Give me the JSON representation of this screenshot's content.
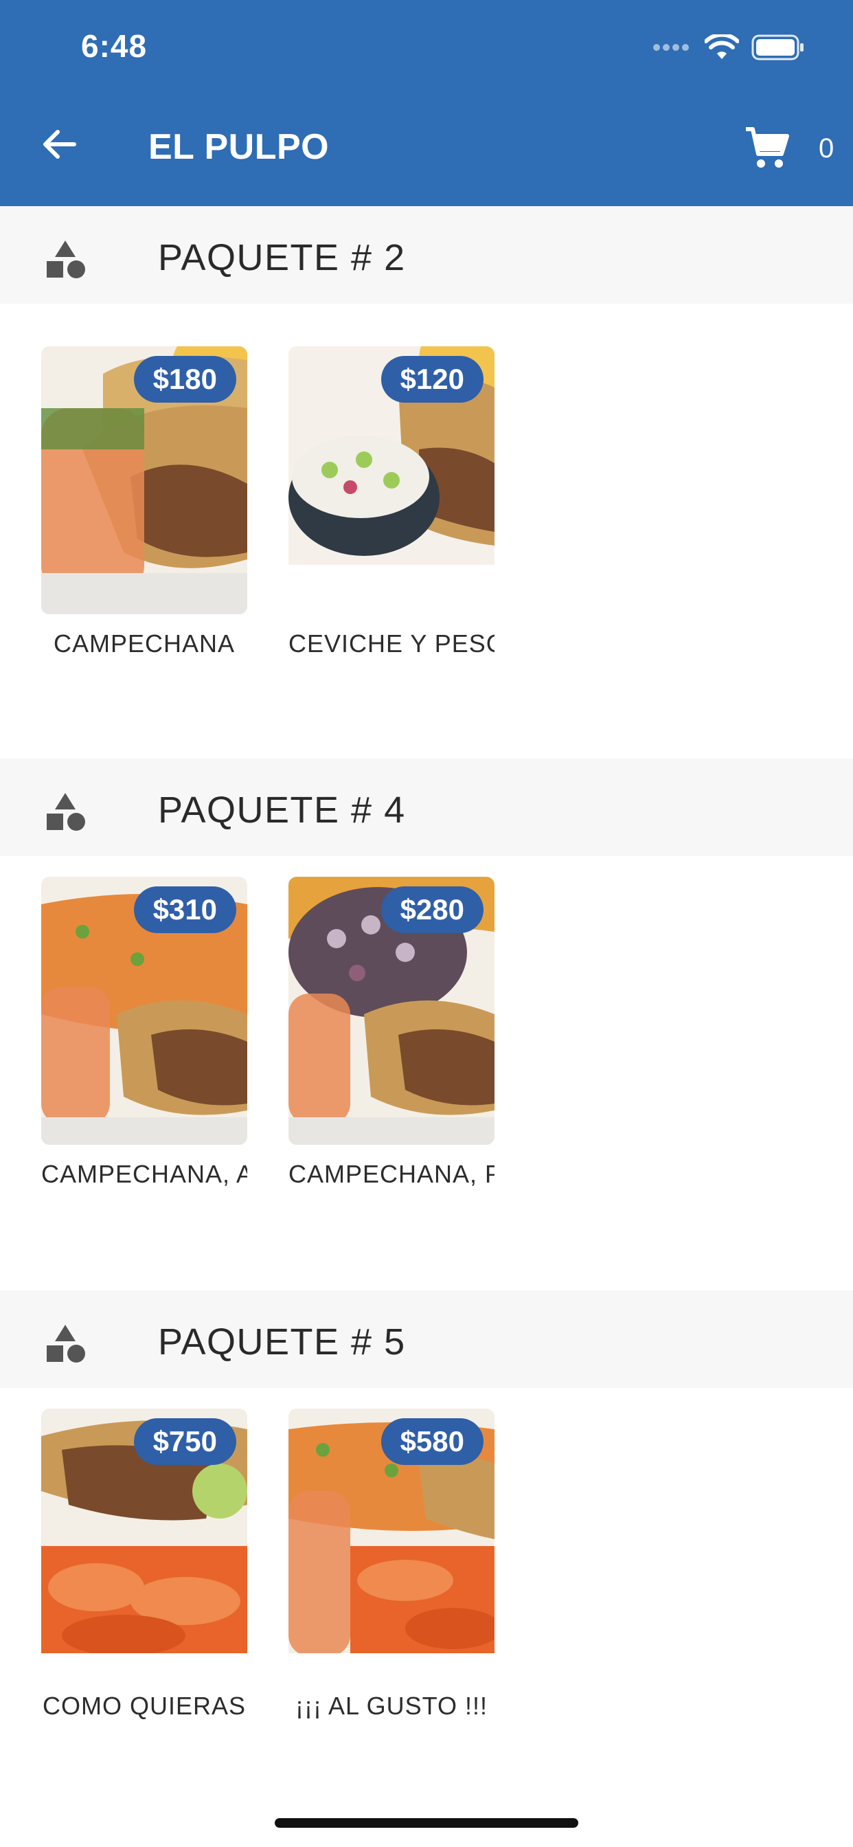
{
  "status_bar": {
    "time": "6:48"
  },
  "header": {
    "title": "EL PULPO",
    "cart_count": "0"
  },
  "colors": {
    "primary": "#2f6db5",
    "price_badge": "#2f5fa7",
    "section_bg": "#f7f7f7"
  },
  "icons": {
    "back": "arrow-left-icon",
    "cart": "cart-icon",
    "category": "shapes-icon"
  },
  "sections": [
    {
      "title": "PAQUETE  # 2",
      "items": [
        {
          "price": "$180",
          "name": "CAMPECHANA"
        },
        {
          "price": "$120",
          "name": "CEVICHE Y PESCADO"
        }
      ]
    },
    {
      "title": "PAQUETE  # 4",
      "items": [
        {
          "price": "$310",
          "name": "CAMPECHANA, ARROZ"
        },
        {
          "price": "$280",
          "name": "CAMPECHANA, PULPO"
        }
      ]
    },
    {
      "title": "PAQUETE  # 5",
      "items": [
        {
          "price": "$750",
          "name": "COMO QUIERAS"
        },
        {
          "price": "$580",
          "name": "¡¡¡ AL GUSTO !!!"
        }
      ]
    }
  ]
}
